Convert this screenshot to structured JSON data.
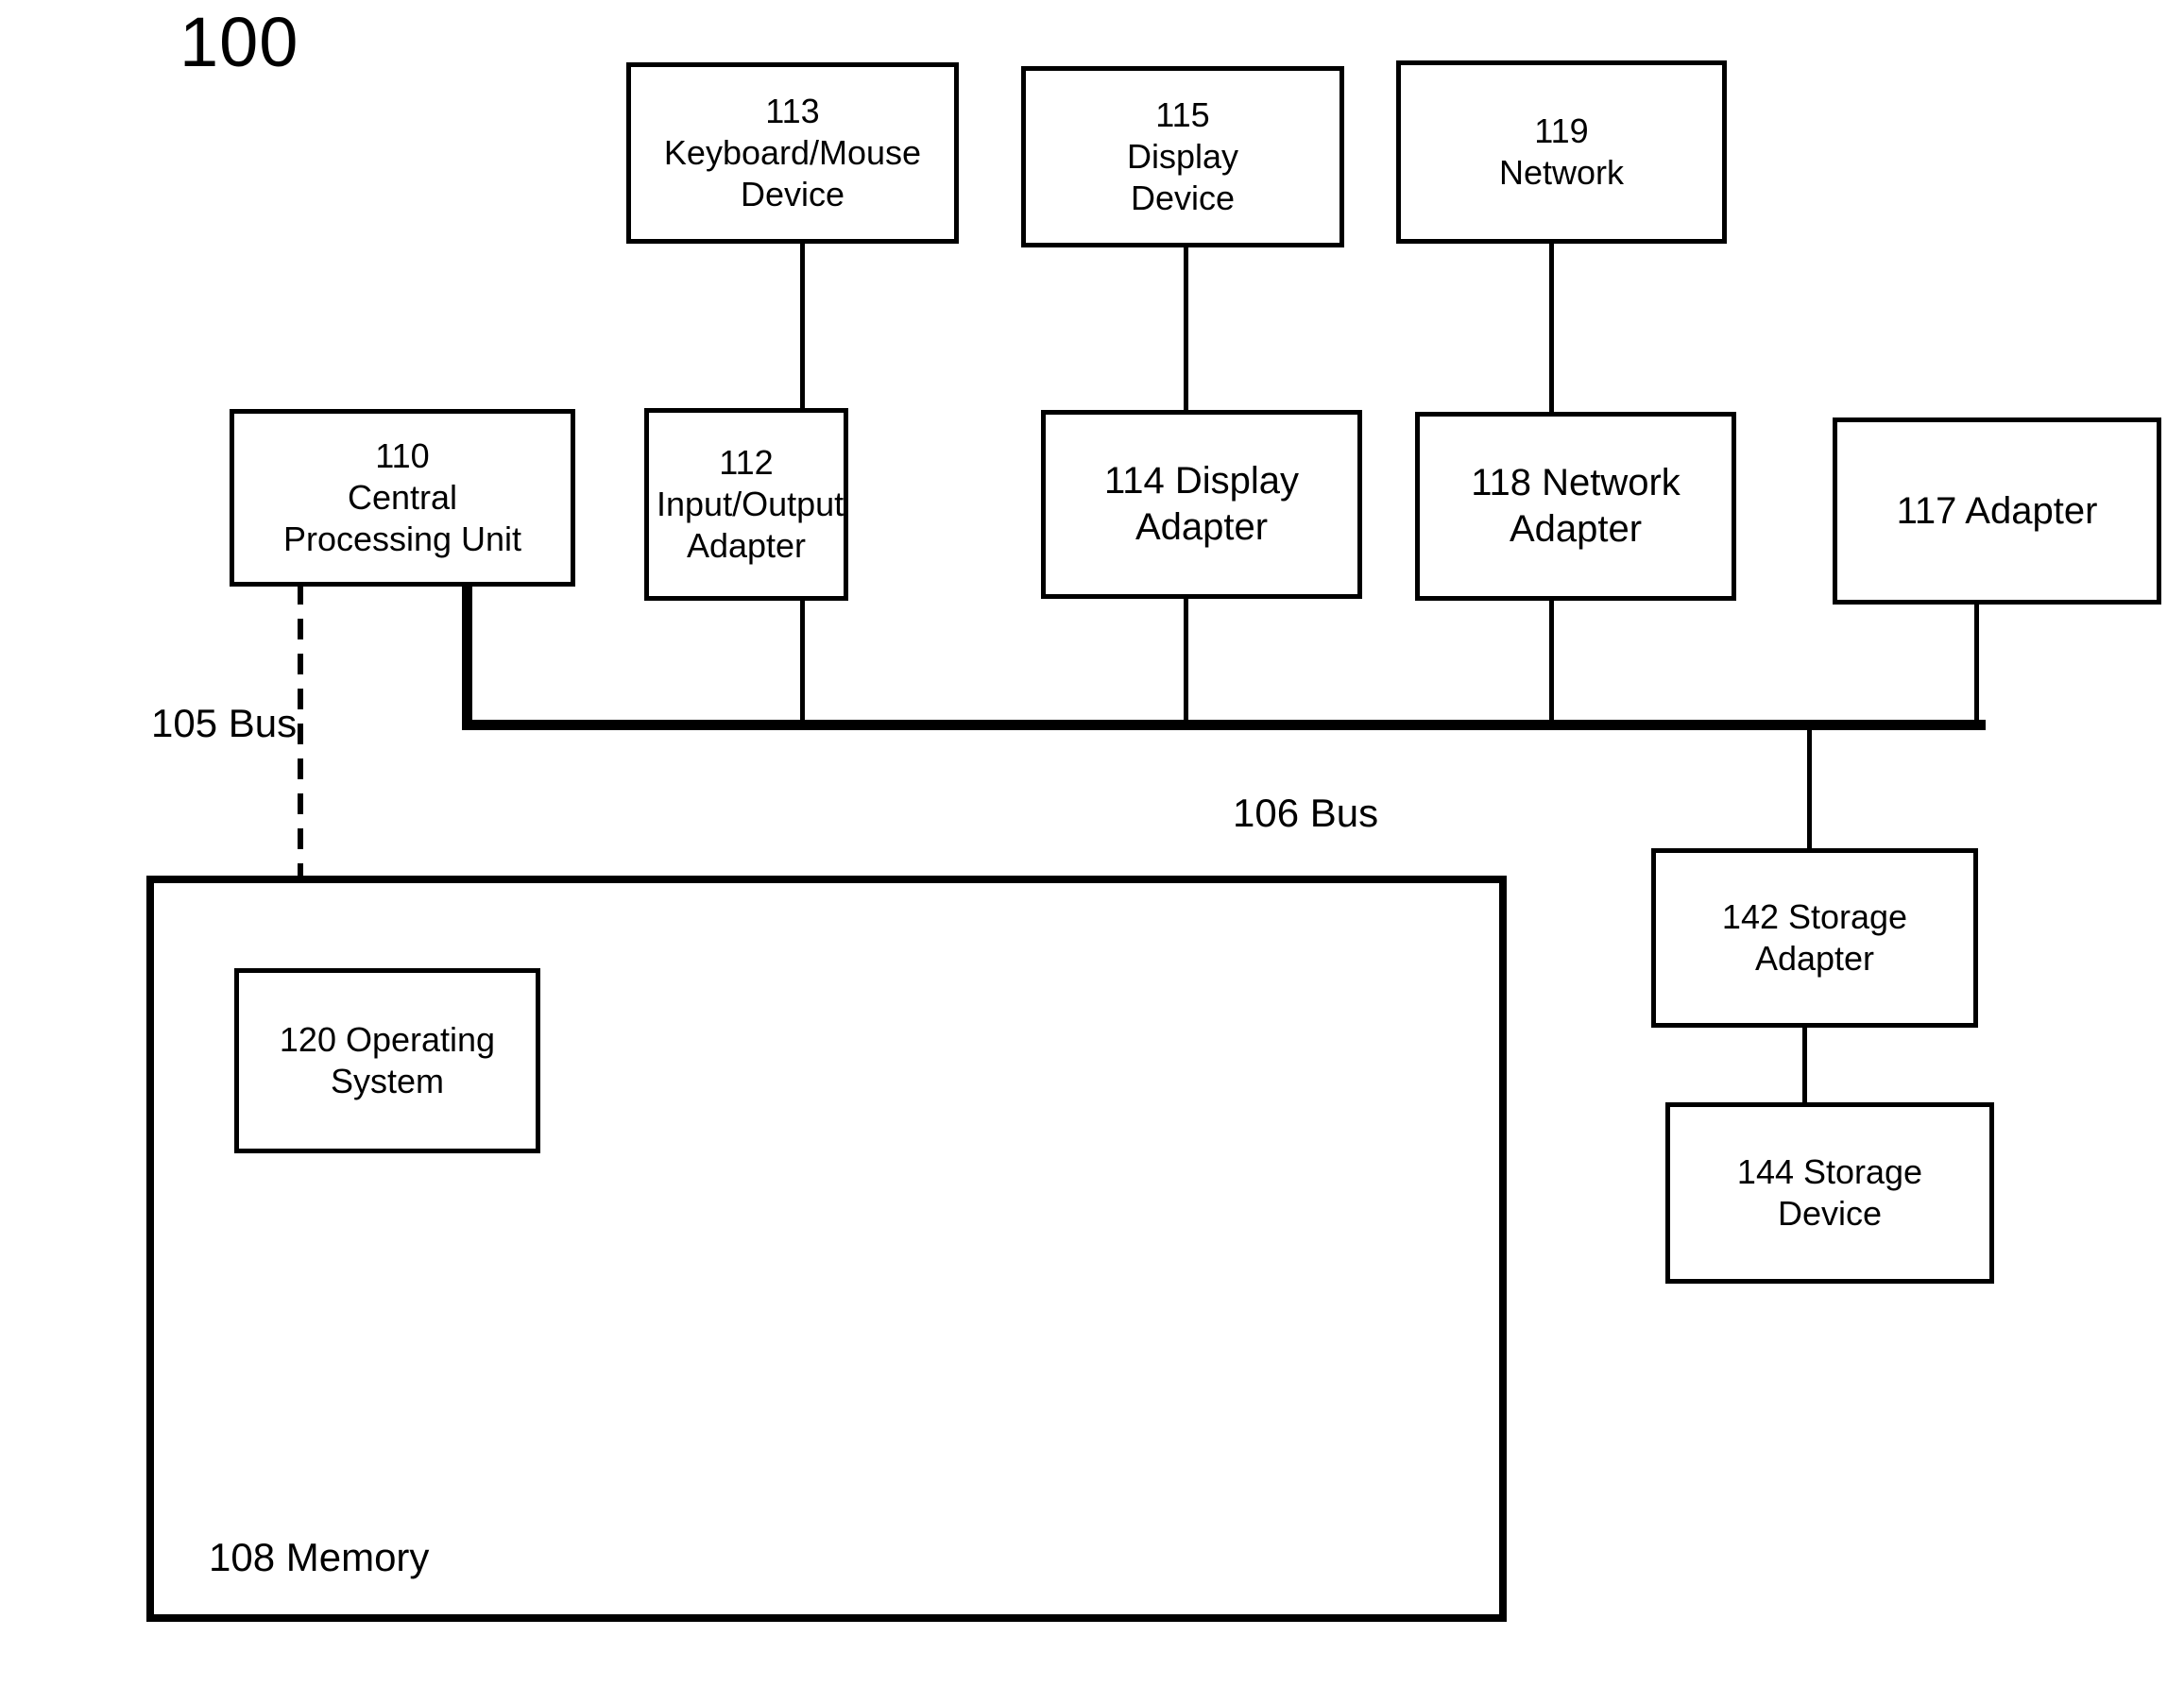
{
  "figure": {
    "number": "100"
  },
  "boxes": {
    "keyboard_mouse_device": {
      "ref": "113",
      "line1": "113",
      "line2": "Keyboard/Mouse",
      "line3": "Device"
    },
    "display_device": {
      "ref": "115",
      "line1": "115",
      "line2": "Display",
      "line3": "Device"
    },
    "network": {
      "ref": "119",
      "line1": "119",
      "line2": "Network"
    },
    "central_processing_unit": {
      "ref": "110",
      "line1": "110",
      "line2": "Central",
      "line3": "Processing Unit"
    },
    "input_output_adapter": {
      "ref": "112",
      "line1": "112",
      "line2": "Input/Output",
      "line3": "Adapter"
    },
    "display_adapter": {
      "ref": "114",
      "line1": "114 Display",
      "line2": "Adapter"
    },
    "network_adapter": {
      "ref": "118",
      "line1": "118 Network",
      "line2": "Adapter"
    },
    "adapter_117": {
      "ref": "117",
      "line1": "117 Adapter"
    },
    "storage_adapter": {
      "ref": "142",
      "line1": "142 Storage",
      "line2": "Adapter"
    },
    "storage_device": {
      "ref": "144",
      "line1": "144 Storage",
      "line2": "Device"
    },
    "memory": {
      "ref": "108",
      "label": "108 Memory"
    },
    "operating_system": {
      "ref": "120",
      "line1": "120 Operating",
      "line2": "System"
    }
  },
  "labels": {
    "bus_105": "105 Bus",
    "bus_106": "106 Bus"
  },
  "colors": {
    "stroke": "#000000",
    "background": "#ffffff",
    "text": "#000000"
  }
}
